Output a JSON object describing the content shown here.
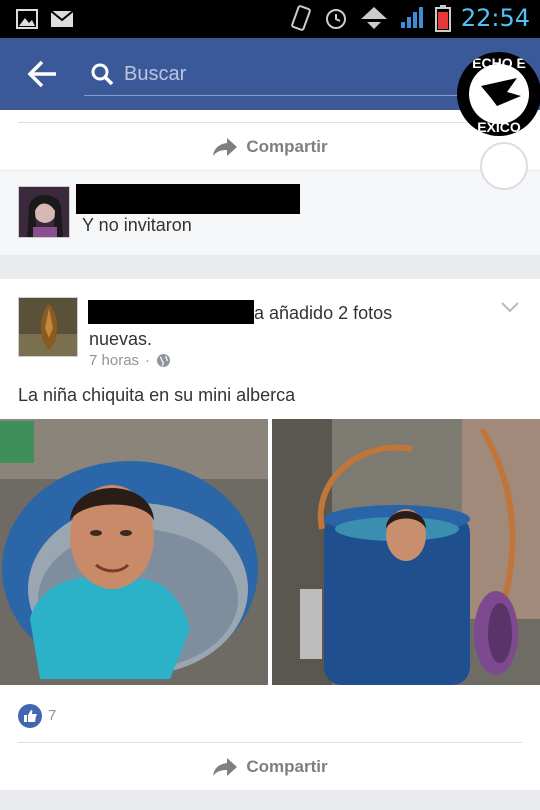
{
  "status_bar": {
    "time": "22:54"
  },
  "nav": {
    "search_placeholder": "Buscar"
  },
  "chathead": {
    "label_top": "ECHO E",
    "label_bottom": "EXICO"
  },
  "top_card": {
    "share_label": "Compartir"
  },
  "comment_card": {
    "text": "Y no invitaron"
  },
  "post": {
    "header_suffix": "a añadido 2 fotos",
    "header_line2": "nuevas.",
    "time": "7 horas",
    "separator": "·",
    "caption": "La niña chiquita en su mini alberca",
    "like_count": "7",
    "share_label": "Compartir"
  },
  "colors": {
    "brand": "#3b5998",
    "like": "#4267b2"
  }
}
